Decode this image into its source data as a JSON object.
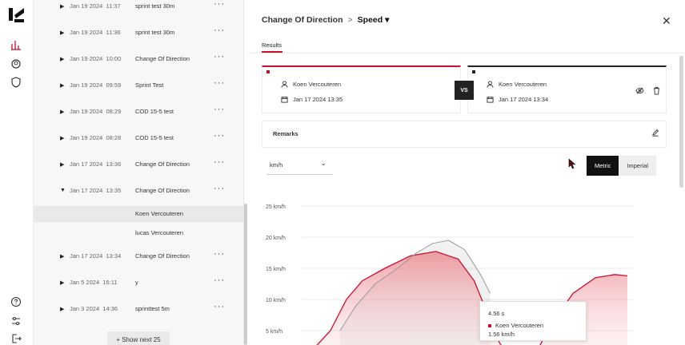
{
  "sessions": [
    {
      "date": "Jan 19 2024",
      "time": "11:37",
      "name": "sprint test 30m",
      "expanded": false
    },
    {
      "date": "Jan 19 2024",
      "time": "11:36",
      "name": "sprint test 30m",
      "expanded": false
    },
    {
      "date": "Jan 19 2024",
      "time": "10:00",
      "name": "Change Of Direction",
      "expanded": false
    },
    {
      "date": "Jan 19 2024",
      "time": "09:59",
      "name": "Sprint Test",
      "expanded": false
    },
    {
      "date": "Jan 19 2024",
      "time": "08:29",
      "name": "COD 15-5 test",
      "expanded": false
    },
    {
      "date": "Jan 19 2024",
      "time": "08:28",
      "name": "COD 15-5 test",
      "expanded": false
    },
    {
      "date": "Jan 17 2024",
      "time": "13:36",
      "name": "Change Of Direction",
      "expanded": false
    },
    {
      "date": "Jan 17 2024",
      "time": "13:35",
      "name": "Change Of Direction",
      "expanded": true
    },
    {
      "date": "Jan 17 2024",
      "time": "13:34",
      "name": "Change Of Direction",
      "expanded": false
    },
    {
      "date": "Jan 5 2024",
      "time": "16:11",
      "name": "y",
      "expanded": false
    },
    {
      "date": "Jan 3 2024",
      "time": "14:36",
      "name": "sprinttest 5m",
      "expanded": false
    }
  ],
  "sub_items": [
    "Koen Vercouteren",
    "lucas Vercouteren"
  ],
  "more_glyph": "···",
  "show_next": "+ Show next 25",
  "header": {
    "crumb_parent": "Change Of Direction",
    "crumb_sep": ">",
    "crumb_current": "Speed",
    "crumb_caret": "▾",
    "close": "✕"
  },
  "tabs": {
    "results": "Results"
  },
  "compare": {
    "a": {
      "athlete": "Koen Vercouteren",
      "datetime": "Jan 17 2024 13:35",
      "color": "#c8102e"
    },
    "b": {
      "athlete": "Koen Vercouteren",
      "datetime": "Jan 17 2024 13:34",
      "color": "#222222"
    },
    "vs": "VS"
  },
  "remarks": {
    "label": "Remarks"
  },
  "units": {
    "selected": "km/h",
    "chevron": "⌄"
  },
  "toggle": {
    "metric": "Metric",
    "imperial": "Imperial"
  },
  "chart_data": {
    "type": "area",
    "ylabel": "",
    "yticks": [
      "25 km/h",
      "20 km/h",
      "15 km/h",
      "10 km/h",
      "5 km/h"
    ],
    "ylim": [
      0,
      25
    ],
    "grid": true,
    "series": [
      {
        "name": "Koen Vercouteren",
        "color": "#c8102e",
        "values": [
          {
            "x": 0,
            "y": 0
          },
          {
            "x": 0.9,
            "y": 5
          },
          {
            "x": 1.4,
            "y": 10
          },
          {
            "x": 1.9,
            "y": 13
          },
          {
            "x": 2.6,
            "y": 15
          },
          {
            "x": 3.4,
            "y": 17
          },
          {
            "x": 4.2,
            "y": 17.7
          },
          {
            "x": 4.9,
            "y": 16.5
          },
          {
            "x": 5.4,
            "y": 13
          },
          {
            "x": 5.8,
            "y": 8
          },
          {
            "x": 6.2,
            "y": 3
          },
          {
            "x": 6.6,
            "y": 0
          },
          {
            "x": 7.2,
            "y": 0
          },
          {
            "x": 7.8,
            "y": 6
          },
          {
            "x": 8.5,
            "y": 11
          },
          {
            "x": 9.2,
            "y": 13.5
          },
          {
            "x": 9.8,
            "y": 14
          },
          {
            "x": 10.2,
            "y": 13.8
          }
        ]
      },
      {
        "name": "",
        "color": "#999999",
        "values": [
          {
            "x": 1.2,
            "y": 5
          },
          {
            "x": 1.7,
            "y": 9
          },
          {
            "x": 2.3,
            "y": 12.5
          },
          {
            "x": 3.0,
            "y": 15
          },
          {
            "x": 3.6,
            "y": 17.5
          },
          {
            "x": 4.1,
            "y": 19
          },
          {
            "x": 4.6,
            "y": 19.5
          },
          {
            "x": 5.1,
            "y": 18
          },
          {
            "x": 5.6,
            "y": 14
          },
          {
            "x": 5.9,
            "y": 11
          }
        ]
      }
    ],
    "tooltip": {
      "time": "4.56 s",
      "athlete": "Koen Vercouteren",
      "value": "1.56 km/h"
    }
  }
}
